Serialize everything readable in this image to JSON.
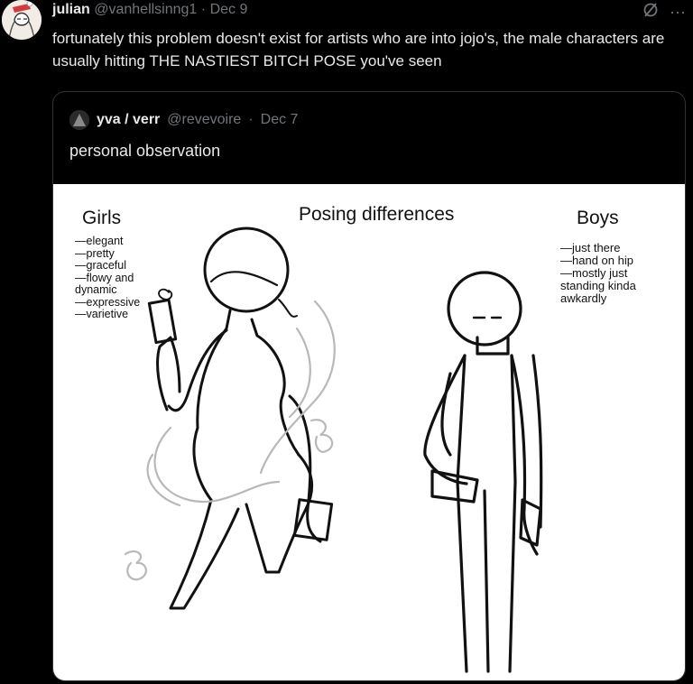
{
  "tweet": {
    "name": "julian",
    "handle": "@vanhellsinng1",
    "sep": "·",
    "date": "Dec 9",
    "text": "fortunately this problem doesn't exist for artists who are into jojo's, the male characters are usually hitting THE NASTIEST BITCH POSE you've seen",
    "more_glyph": "···"
  },
  "quote": {
    "name": "yva / verr",
    "handle": "@revevoire",
    "sep": "·",
    "date": "Dec 7",
    "text": "personal observation",
    "image": {
      "title": "Posing differences",
      "girls_heading": "Girls",
      "girls_list": "—elegant\n—pretty\n—graceful\n—flowy and\ndynamic\n—expressive\n—varietive",
      "boys_heading": "Boys",
      "boys_list": "—just there\n—hand on hip\n—mostly just\nstanding kinda\nawkardly"
    }
  },
  "icons": [
    "grok-icon",
    "more-icon"
  ]
}
